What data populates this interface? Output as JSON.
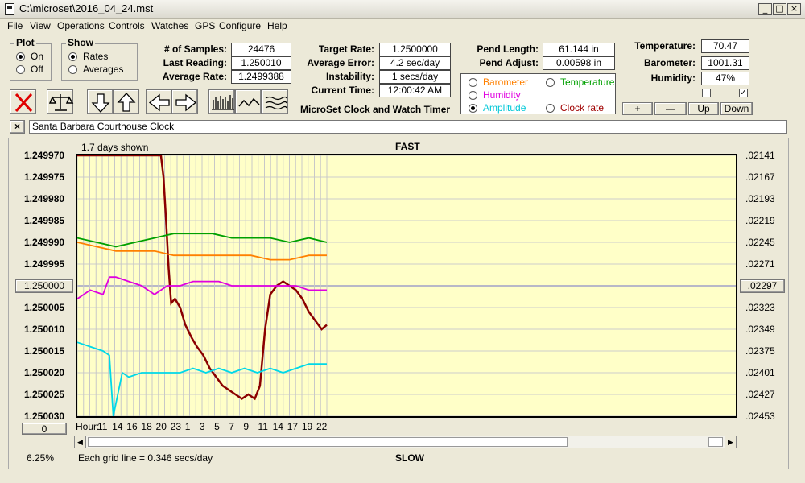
{
  "window": {
    "title": "C:\\microset\\2016_04_24.mst",
    "min": "_",
    "max": "□",
    "close": "×"
  },
  "menu": [
    "File",
    "View",
    "Operations",
    "Controls",
    "Watches",
    "GPS",
    "Configure",
    "Help"
  ],
  "plot_group": {
    "title": "Plot",
    "on": "On",
    "off": "Off",
    "selected": "On"
  },
  "show_group": {
    "title": "Show",
    "rates": "Rates",
    "averages": "Averages",
    "selected": "Rates"
  },
  "stats": {
    "samples_label": "# of Samples:",
    "samples": "24476",
    "last_label": "Last Reading:",
    "last": "1.250010",
    "avg_label": "Average Rate:",
    "avg": "1.2499388"
  },
  "target": {
    "target_label": "Target Rate:",
    "target": "1.2500000",
    "err_label": "Average Error:",
    "err": "4.2 sec/day",
    "inst_label": "Instability:",
    "inst": "1 secs/day",
    "time_label": "Current Time:",
    "time": "12:00:42 AM"
  },
  "app_caption": "MicroSet Clock and Watch Timer",
  "pend": {
    "length_label": "Pend Length:",
    "length": "61.144 in",
    "adjust_label": "Pend Adjust:",
    "adjust": "0.00598 in"
  },
  "env": {
    "temp_label": "Temperature:",
    "temp": "70.47",
    "baro_label": "Barometer:",
    "baro": "1001.31",
    "hum_label": "Humidity:",
    "hum": "47%",
    "check1": "",
    "check2": "✓"
  },
  "overlay": {
    "barometer": "Barometer",
    "temperature": "Temperature",
    "humidity": "Humidity",
    "amplitude": "Amplitude",
    "clock_rate": "Clock rate",
    "selected": "Amplitude",
    "colors": {
      "barometer": "#ff8000",
      "temperature": "#00a000",
      "humidity": "#e000e0",
      "amplitude": "#00d8e8",
      "clock_rate": "#a00000"
    }
  },
  "adjust_buttons": {
    "plus": "+",
    "minus": "—",
    "up": "Up",
    "down": "Down"
  },
  "toolbar_icons": [
    "close-red-x-icon",
    "balance-scale-icon",
    "arrow-down-icon",
    "arrow-up-icon",
    "arrow-left-icon",
    "arrow-right-icon",
    "bars-icon",
    "wave-icon",
    "multi-wave-icon"
  ],
  "watch_name": {
    "close": "×",
    "name": "Santa Barbara Courthouse Clock"
  },
  "chart_caption": {
    "days_shown": "1.7 days shown",
    "fast": "FAST",
    "slow": "SLOW",
    "grid": "Each grid line = 0.346 secs/day",
    "pct": "6.25%",
    "hour_label": "Hour:"
  },
  "left_buttons": {
    "center": "1.250000",
    "zero": "0"
  },
  "right_button": ".02297",
  "chart_data": {
    "type": "line",
    "y_left_ticks": [
      "1.249970",
      "1.249975",
      "1.249980",
      "1.249985",
      "1.249990",
      "1.249995",
      "1.250000",
      "1.250005",
      "1.250010",
      "1.250015",
      "1.250020",
      "1.250025",
      "1.250030"
    ],
    "y_right_ticks": [
      ".02141",
      ".02167",
      ".02193",
      ".02219",
      ".02245",
      ".02271",
      ".02297",
      ".02323",
      ".02349",
      ".02375",
      ".02401",
      ".02427",
      ".02453"
    ],
    "x_ticks": [
      "11",
      "14",
      "16",
      "18",
      "20",
      "23",
      "1",
      "3",
      "5",
      "7",
      "9",
      "11",
      "14",
      "17",
      "19",
      "22"
    ],
    "ylim": [
      1.24997,
      1.25003
    ],
    "grid": true,
    "series": [
      {
        "key": "clock_rate",
        "color": "#8b0000",
        "points": [
          [
            0,
            1.24997
          ],
          [
            8,
            1.24997
          ],
          [
            10,
            1.24997
          ],
          [
            12,
            1.24997
          ],
          [
            13,
            1.24997
          ],
          [
            13.4,
            1.249975
          ],
          [
            13.8,
            1.249985
          ],
          [
            14.2,
            1.249996
          ],
          [
            14.6,
            1.250004
          ],
          [
            15.2,
            1.250003
          ],
          [
            16,
            1.250005
          ],
          [
            16.8,
            1.250009
          ],
          [
            17.8,
            1.250012
          ],
          [
            18.6,
            1.250014
          ],
          [
            19.6,
            1.250016
          ],
          [
            20.6,
            1.250019
          ],
          [
            21.6,
            1.250021
          ],
          [
            22.6,
            1.250023
          ],
          [
            23.6,
            1.250024
          ],
          [
            24.6,
            1.250025
          ],
          [
            25.6,
            1.250026
          ],
          [
            26.6,
            1.250025
          ],
          [
            27.6,
            1.250026
          ],
          [
            28.4,
            1.250023
          ],
          [
            29.2,
            1.25001
          ],
          [
            30,
            1.250002
          ],
          [
            31,
            1.25
          ],
          [
            32,
            1.249999
          ],
          [
            33,
            1.25
          ],
          [
            34,
            1.250001
          ],
          [
            35,
            1.250003
          ],
          [
            36,
            1.250006
          ],
          [
            37,
            1.250008
          ],
          [
            38,
            1.25001
          ],
          [
            38.8,
            1.250009
          ]
        ]
      },
      {
        "key": "temperature",
        "color": "#00a000",
        "points": [
          [
            0,
            1.249989
          ],
          [
            3,
            1.24999
          ],
          [
            6,
            1.249991
          ],
          [
            9,
            1.24999
          ],
          [
            12,
            1.249989
          ],
          [
            15,
            1.249988
          ],
          [
            18,
            1.249988
          ],
          [
            21,
            1.249988
          ],
          [
            24,
            1.249989
          ],
          [
            27,
            1.249989
          ],
          [
            30,
            1.249989
          ],
          [
            33,
            1.24999
          ],
          [
            36,
            1.249989
          ],
          [
            38.8,
            1.24999
          ]
        ]
      },
      {
        "key": "barometer",
        "color": "#ff8000",
        "points": [
          [
            0,
            1.24999
          ],
          [
            3,
            1.249991
          ],
          [
            6,
            1.249992
          ],
          [
            9,
            1.249992
          ],
          [
            12,
            1.249992
          ],
          [
            15,
            1.249993
          ],
          [
            18,
            1.249993
          ],
          [
            21,
            1.249993
          ],
          [
            24,
            1.249993
          ],
          [
            27,
            1.249993
          ],
          [
            30,
            1.249994
          ],
          [
            33,
            1.249994
          ],
          [
            36,
            1.249993
          ],
          [
            38.8,
            1.249993
          ]
        ]
      },
      {
        "key": "humidity",
        "color": "#e000e0",
        "points": [
          [
            0,
            1.250003
          ],
          [
            2,
            1.250001
          ],
          [
            4,
            1.250002
          ],
          [
            5,
            1.249998
          ],
          [
            6,
            1.249998
          ],
          [
            8,
            1.249999
          ],
          [
            10,
            1.25
          ],
          [
            12,
            1.250002
          ],
          [
            14,
            1.25
          ],
          [
            16,
            1.25
          ],
          [
            18,
            1.249999
          ],
          [
            20,
            1.249999
          ],
          [
            22,
            1.249999
          ],
          [
            24,
            1.25
          ],
          [
            26,
            1.25
          ],
          [
            28,
            1.25
          ],
          [
            30,
            1.25
          ],
          [
            32,
            1.25
          ],
          [
            34,
            1.25
          ],
          [
            36,
            1.250001
          ],
          [
            38.8,
            1.250001
          ]
        ]
      },
      {
        "key": "amplitude",
        "color": "#00d8e8",
        "points": [
          [
            0,
            1.250013
          ],
          [
            2,
            1.250014
          ],
          [
            4,
            1.250015
          ],
          [
            5,
            1.250016
          ],
          [
            5.6,
            1.25003
          ],
          [
            7,
            1.25002
          ],
          [
            8,
            1.250021
          ],
          [
            10,
            1.25002
          ],
          [
            12,
            1.25002
          ],
          [
            14,
            1.25002
          ],
          [
            16,
            1.25002
          ],
          [
            18,
            1.250019
          ],
          [
            20,
            1.25002
          ],
          [
            22,
            1.250019
          ],
          [
            24,
            1.25002
          ],
          [
            26,
            1.250019
          ],
          [
            28,
            1.25002
          ],
          [
            30,
            1.250019
          ],
          [
            32,
            1.25002
          ],
          [
            34,
            1.250019
          ],
          [
            36,
            1.250018
          ],
          [
            38.8,
            1.250018
          ]
        ]
      }
    ]
  }
}
